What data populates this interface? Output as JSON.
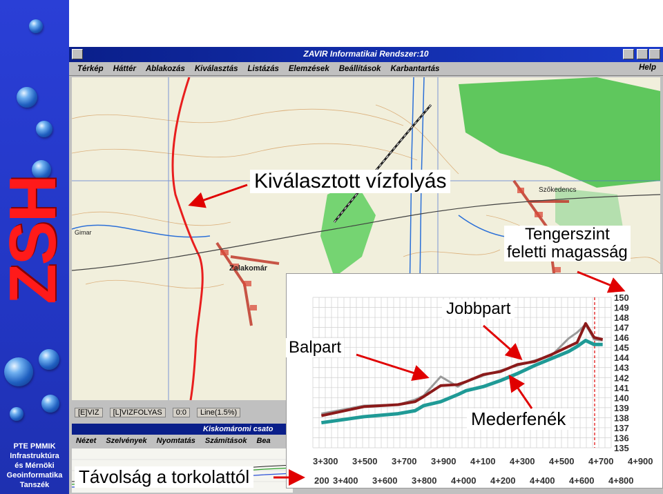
{
  "sidebar": {
    "logo_text": "ZSH",
    "institution": [
      "PTE PMMIK",
      "Infrastruktúra",
      "és Mérnöki",
      "Geoinformatika",
      "Tanszék"
    ]
  },
  "window": {
    "title": "ZAVIR Informatikai Rendszer:10",
    "menu": [
      "Térkép",
      "Háttér",
      "Ablakozás",
      "Kiválasztás",
      "Listázás",
      "Elemzések",
      "Beállítások",
      "Karbantartás"
    ],
    "help": "Help"
  },
  "map": {
    "place_labels": [
      "Szőkedencs",
      "Zalakomár",
      "Gimar"
    ],
    "status": [
      "[E]VIZ",
      "[L]VIZFOLYAS",
      "0:0",
      "Line(1.5%)"
    ]
  },
  "subwindow": {
    "title": "Kiskomáromi csato",
    "menu": [
      "Nézet",
      "Szelvények",
      "Nyomtatás",
      "Számítások",
      "Bea"
    ]
  },
  "callouts": {
    "selected_stream": "Kiválasztott vízfolyás",
    "elevation_line1": "Tengerszint",
    "elevation_line2": "feletti magasság",
    "left_bank": "Balpart",
    "right_bank": "Jobbpart",
    "streambed": "Mederfenék",
    "distance": "Távolság a torkolattól"
  },
  "colors": {
    "right_bank": "#8b1a1a",
    "streambed": "#1f9a96",
    "left_bank": "#9a9a9a",
    "sidebar": "#2236c4",
    "zsh_logo": "#ff1a1a",
    "arrow": "#e00000"
  },
  "chart_data": {
    "type": "line",
    "ylim": [
      135,
      150
    ],
    "y_ticks": [
      150,
      149,
      148,
      147,
      146,
      145,
      144,
      143,
      142,
      141,
      140,
      139,
      138,
      137,
      136,
      135
    ],
    "x_ticks_top": [
      "3+300",
      "3+500",
      "3+700",
      "3+900",
      "4+100",
      "4+300",
      "4+500",
      "4+700",
      "4+900"
    ],
    "x_ticks_bottom": [
      "200",
      "3+400",
      "3+600",
      "3+800",
      "4+000",
      "4+200",
      "4+400",
      "4+600",
      "4+800"
    ],
    "x": [
      3.25,
      3.5,
      3.7,
      3.8,
      3.85,
      3.95,
      4.05,
      4.1,
      4.2,
      4.3,
      4.4,
      4.5,
      4.6,
      4.7,
      4.75,
      4.8,
      4.85,
      4.9
    ],
    "series": [
      {
        "name": "Jobbpart",
        "values": [
          138.2,
          139.1,
          139.3,
          139.6,
          140.1,
          141.2,
          141.3,
          141.6,
          142.3,
          142.6,
          143.3,
          143.6,
          144.3,
          145.1,
          145.5,
          147.4,
          146.0,
          145.8
        ]
      },
      {
        "name": "Balpart",
        "values": [
          138.4,
          139.2,
          139.3,
          139.8,
          140.2,
          142.1,
          141.1,
          141.6,
          142.2,
          142.7,
          143.2,
          143.7,
          144.2,
          145.9,
          146.5,
          147.3,
          145.8,
          145.7
        ]
      },
      {
        "name": "Mederfenék",
        "values": [
          137.5,
          138.1,
          138.4,
          138.7,
          139.2,
          139.6,
          140.3,
          140.7,
          141.1,
          141.7,
          142.4,
          143.2,
          143.9,
          144.6,
          145.1,
          145.7,
          145.3,
          145.3
        ]
      }
    ]
  }
}
